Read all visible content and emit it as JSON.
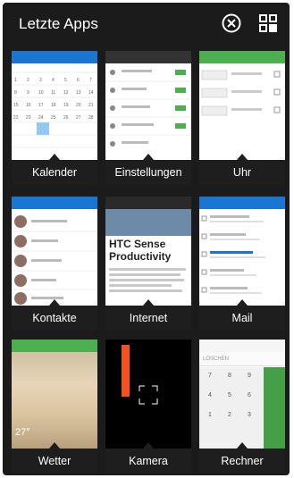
{
  "header": {
    "title": "Letzte Apps",
    "close_icon": "close-circle-icon",
    "grid_icon": "grid-icon"
  },
  "apps": [
    {
      "label": "Kalender"
    },
    {
      "label": "Einstellungen"
    },
    {
      "label": "Uhr"
    },
    {
      "label": "Kontakte"
    },
    {
      "label": "Internet"
    },
    {
      "label": "Mail"
    },
    {
      "label": "Wetter"
    },
    {
      "label": "Kamera"
    },
    {
      "label": "Rechner"
    }
  ],
  "previews": {
    "internet_headline_1": "HTC Sense",
    "internet_headline_2": "Productivity",
    "weather_temp": "27°",
    "calc_display": "LÖSCHEN",
    "calc_keys": [
      "7",
      "8",
      "9",
      "4",
      "5",
      "6",
      "1",
      "2",
      "3"
    ]
  },
  "colors": {
    "background": "#1b1b1b",
    "calendar_accent": "#1976d2",
    "clock_accent": "#4caf50",
    "contacts_accent": "#1976d2",
    "mail_accent": "#1976d2",
    "weather_accent": "#4caf50",
    "camera_accent": "#f4511e"
  }
}
